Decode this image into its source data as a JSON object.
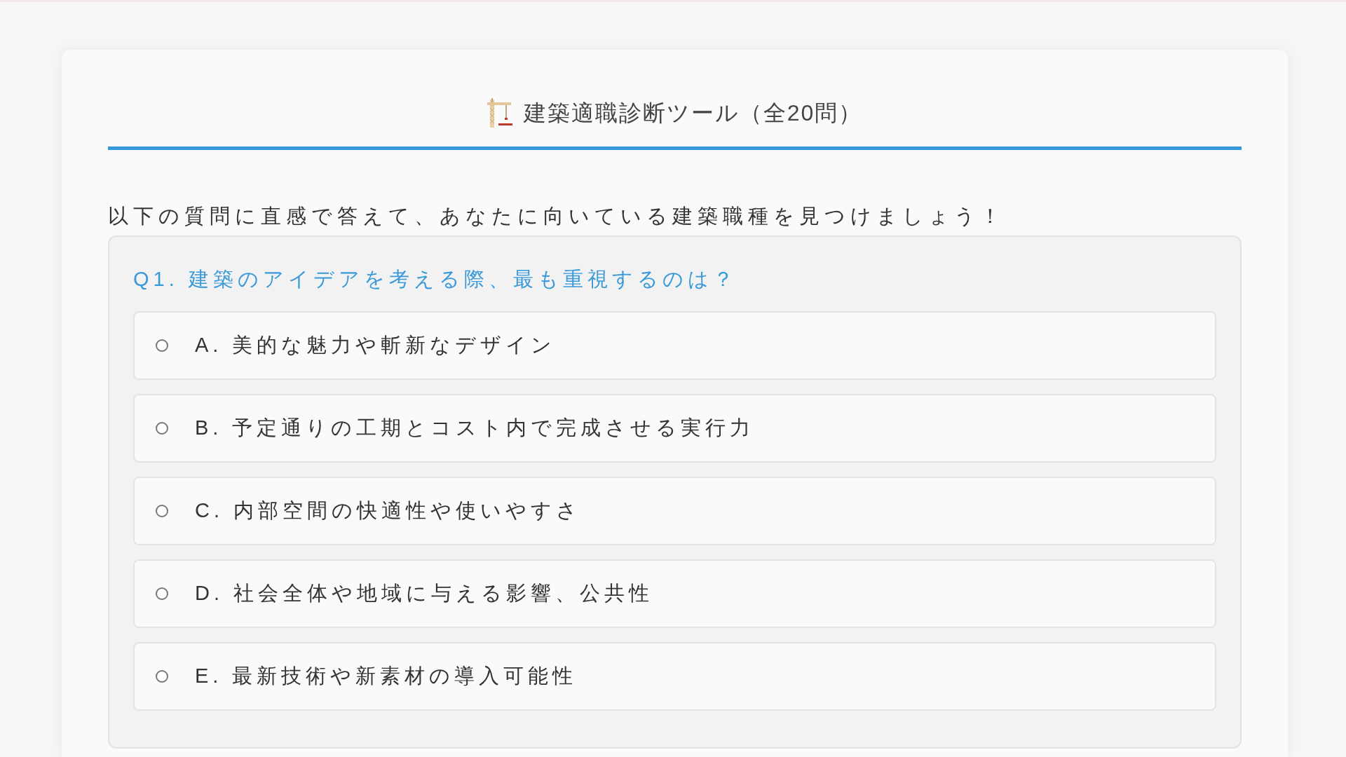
{
  "header": {
    "title": "建築適職診断ツール（全20問）"
  },
  "intro": "以下の質問に直感で答えて、あなたに向いている建築職種を見つけましょう！",
  "question": {
    "text": "Q1. 建築のアイデアを考える際、最も重視するのは？",
    "options": [
      {
        "text": "A. 美的な魅力や斬新なデザイン",
        "selected": false
      },
      {
        "text": "B. 予定通りの工期とコスト内で完成させる実行力",
        "selected": false
      },
      {
        "text": "C. 内部空間の快適性や使いやすさ",
        "selected": false
      },
      {
        "text": "D. 社会全体や地域に与える影響、公共性",
        "selected": false
      },
      {
        "text": "E. 最新技術や新素材の導入可能性",
        "selected": false
      }
    ]
  }
}
